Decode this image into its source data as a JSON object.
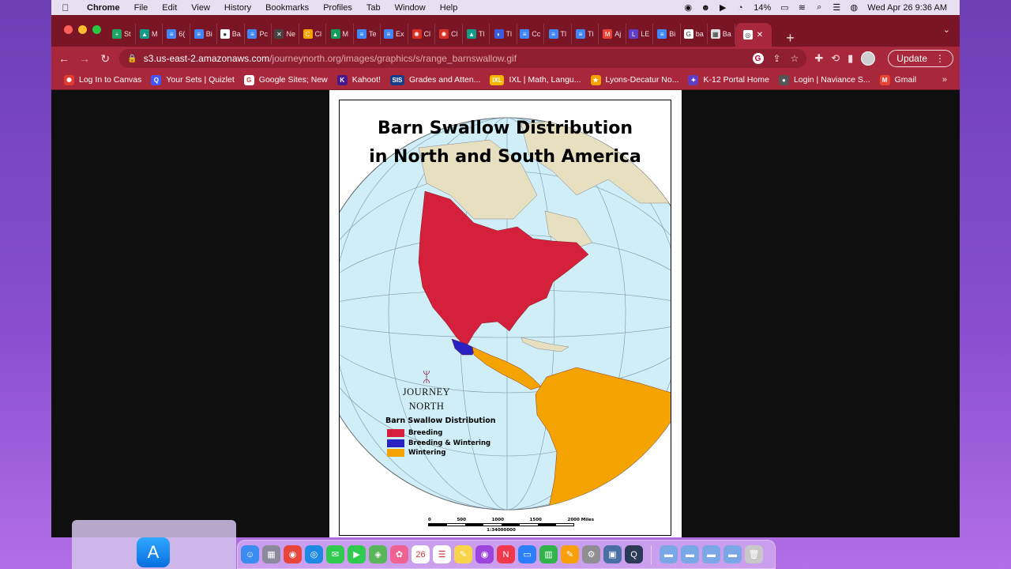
{
  "menubar": {
    "apple": "",
    "app_name": "Chrome",
    "items": [
      "File",
      "Edit",
      "View",
      "History",
      "Bookmarks",
      "Profiles",
      "Tab",
      "Window",
      "Help"
    ],
    "battery": "14%",
    "datetime": "Wed Apr 26  9:36 AM"
  },
  "tabs": [
    {
      "label": "St",
      "color": "#1fa463",
      "glyph": "+"
    },
    {
      "label": "M",
      "color": "#0f9d8a",
      "glyph": "▲"
    },
    {
      "label": "6(",
      "color": "#4285f4",
      "glyph": "≡"
    },
    {
      "label": "Bi",
      "color": "#4285f4",
      "glyph": "≡"
    },
    {
      "label": "Ba",
      "color": "#ffffff",
      "glyph": "●"
    },
    {
      "label": "Pc",
      "color": "#4285f4",
      "glyph": "≡"
    },
    {
      "label": "Ne",
      "color": "#444444",
      "glyph": "✕"
    },
    {
      "label": "Cl",
      "color": "#f4a300",
      "glyph": "C"
    },
    {
      "label": "M",
      "color": "#0f9d58",
      "glyph": "▲"
    },
    {
      "label": "Te",
      "color": "#4285f4",
      "glyph": "≡"
    },
    {
      "label": "Ex",
      "color": "#4285f4",
      "glyph": "≡"
    },
    {
      "label": "Cl",
      "color": "#d93025",
      "glyph": "✺"
    },
    {
      "label": "Cl",
      "color": "#d93025",
      "glyph": "✺"
    },
    {
      "label": "Tl",
      "color": "#0f9d8a",
      "glyph": "▲"
    },
    {
      "label": "Tl",
      "color": "#3b5bdb",
      "glyph": "◐"
    },
    {
      "label": "Cc",
      "color": "#4285f4",
      "glyph": "≡"
    },
    {
      "label": "Tl",
      "color": "#4285f4",
      "glyph": "≡"
    },
    {
      "label": "Tl",
      "color": "#4285f4",
      "glyph": "≡"
    },
    {
      "label": "Aj",
      "color": "#ea4335",
      "glyph": "M"
    },
    {
      "label": "LE",
      "color": "#5f3dc4",
      "glyph": "L"
    },
    {
      "label": "Bi",
      "color": "#4285f4",
      "glyph": "≡"
    },
    {
      "label": "ba",
      "color": "#ffffff",
      "glyph": "G"
    },
    {
      "label": "Ba",
      "color": "#dddddd",
      "glyph": "▦"
    }
  ],
  "active_tab": {
    "label": "",
    "close": "✕"
  },
  "newtab": "+",
  "tabmenu": "⌄",
  "toolbar": {
    "back": "←",
    "forward": "→",
    "reload": "↻",
    "url_host": "s3.us-east-2.amazonaws.com",
    "url_path": "/journeynorth.org/images/graphics/s/range_barnswallow.gif",
    "update_label": "Update"
  },
  "bookmarks": [
    {
      "label": "Log In to Canvas",
      "color": "#e03c31",
      "glyph": "✺"
    },
    {
      "label": "Your Sets | Quizlet",
      "color": "#4255ff",
      "glyph": "Q"
    },
    {
      "label": "Google Sites; New",
      "color": "#ffffff",
      "glyph": "G"
    },
    {
      "label": "Kahoot!",
      "color": "#46178f",
      "glyph": "K"
    },
    {
      "label": "Grades and Atten...",
      "color": "#1a3b8a",
      "glyph": "SIS"
    },
    {
      "label": "IXL | Math, Langu...",
      "color": "#f4b400",
      "glyph": "IXL"
    },
    {
      "label": "Lyons-Decatur No...",
      "color": "#f4a300",
      "glyph": "★"
    },
    {
      "label": "K-12 Portal Home",
      "color": "#5f3dc4",
      "glyph": "✦"
    },
    {
      "label": "Login | Naviance S...",
      "color": "#555555",
      "glyph": "●"
    },
    {
      "label": "Gmail",
      "color": "#ea4335",
      "glyph": "M"
    }
  ],
  "bookmarks_more": "»",
  "map": {
    "title_line1": "Barn Swallow Distribution",
    "title_line2": "in North and South America",
    "logo_text": "JOURNEY NORTH",
    "legend_title": "Barn Swallow Distribution",
    "legend": [
      {
        "label": "Breeding",
        "color": "#d4203a"
      },
      {
        "label": "Breeding & Wintering",
        "color": "#2a22c0"
      },
      {
        "label": "Wintering",
        "color": "#f5a300"
      }
    ],
    "scale_labels": [
      "0",
      "500",
      "1000",
      "1500",
      "2000 Miles"
    ],
    "scale_ratio": "1:34000000",
    "colors": {
      "ocean": "#cfeef8",
      "land": "#e6dfc0",
      "breeding": "#d4203a",
      "both": "#2a22c0",
      "wintering": "#f5a300"
    }
  },
  "dock": {
    "appstore": "A",
    "icons": [
      {
        "name": "finder-icon",
        "color": "#3b8cf0",
        "glyph": "☺"
      },
      {
        "name": "launchpad-icon",
        "color": "#8a8a9a",
        "glyph": "▦"
      },
      {
        "name": "chrome-icon",
        "color": "#e8453c",
        "glyph": "◉"
      },
      {
        "name": "safari-icon",
        "color": "#1e88e5",
        "glyph": "◎"
      },
      {
        "name": "messages-icon",
        "color": "#2fcb4f",
        "glyph": "✉"
      },
      {
        "name": "facetime-icon",
        "color": "#2fcb4f",
        "glyph": "▶"
      },
      {
        "name": "maps-icon",
        "color": "#5ab65a",
        "glyph": "◈"
      },
      {
        "name": "photos-icon",
        "color": "#f06292",
        "glyph": "✿"
      },
      {
        "name": "calendar-icon",
        "color": "#ffffff",
        "glyph": "26"
      },
      {
        "name": "reminders-icon",
        "color": "#ffffff",
        "glyph": "☰"
      },
      {
        "name": "notes-icon",
        "color": "#f7d44a",
        "glyph": "✎"
      },
      {
        "name": "podcasts-icon",
        "color": "#9c44dc",
        "glyph": "◉"
      },
      {
        "name": "news-icon",
        "color": "#f0374c",
        "glyph": "N"
      },
      {
        "name": "keynote-icon",
        "color": "#2d7ff9",
        "glyph": "▭"
      },
      {
        "name": "numbers-icon",
        "color": "#2fb34a",
        "glyph": "▥"
      },
      {
        "name": "pages-icon",
        "color": "#f8a00c",
        "glyph": "✎"
      },
      {
        "name": "settings-icon",
        "color": "#8e8e93",
        "glyph": "⚙"
      },
      {
        "name": "preview-icon",
        "color": "#4a6fa5",
        "glyph": "▣"
      },
      {
        "name": "quicktime-icon",
        "color": "#2b3a55",
        "glyph": "Q"
      },
      {
        "name": "folder-icon",
        "color": "#7aa7e6",
        "glyph": "▬"
      },
      {
        "name": "folder-icon",
        "color": "#7aa7e6",
        "glyph": "▬"
      },
      {
        "name": "folder-icon",
        "color": "#7aa7e6",
        "glyph": "▬"
      },
      {
        "name": "folder-icon",
        "color": "#7aa7e6",
        "glyph": "▬"
      },
      {
        "name": "trash-icon",
        "color": "#c8c8c8",
        "glyph": "🗑"
      }
    ]
  }
}
